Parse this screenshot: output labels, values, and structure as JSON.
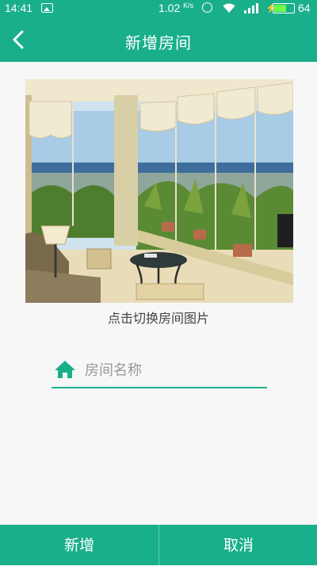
{
  "status_bar": {
    "time": "14:41",
    "net_speed": "1.02",
    "net_speed_unit": "K/s",
    "battery_level": "64",
    "battery_fraction": 0.64,
    "icons": [
      "gallery-icon",
      "alarm-icon",
      "wifi-icon",
      "signal-icon",
      "charging-icon",
      "battery-icon"
    ]
  },
  "app_bar": {
    "title": "新增房间",
    "back_icon": "chevron-left-icon"
  },
  "room_image": {
    "caption": "点击切换房间图片"
  },
  "room_name": {
    "value": "",
    "placeholder": "房间名称",
    "icon": "home-icon"
  },
  "actions": {
    "add_label": "新增",
    "cancel_label": "取消"
  },
  "colors": {
    "primary": "#1aaf8b",
    "background": "#f7f7f7"
  }
}
